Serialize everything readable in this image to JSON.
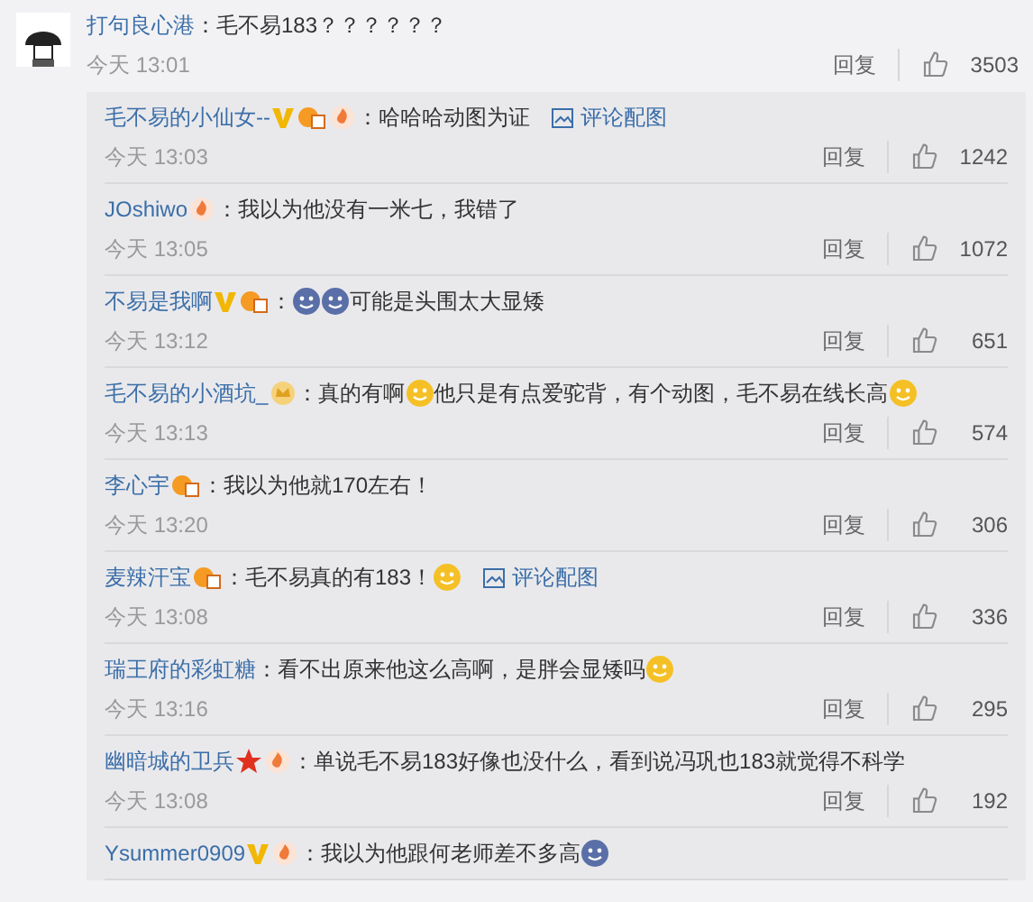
{
  "comment": {
    "name": "打句良心港",
    "segments": [
      {
        "kind": "text",
        "text": "：毛不易183？？？？？？"
      }
    ],
    "time": "今天 13:01",
    "reply_label": "回复",
    "likes": "3503"
  },
  "replies": [
    {
      "name": "毛不易的小仙女--",
      "badges": [
        {
          "kind": "vip"
        },
        {
          "kind": "fan"
        },
        {
          "kind": "flame"
        }
      ],
      "segments": [
        {
          "kind": "text",
          "text": "：哈哈哈动图为证"
        }
      ],
      "image_link": "评论配图",
      "time": "今天 13:03",
      "reply_label": "回复",
      "likes": "1242"
    },
    {
      "name": "JOshiwo",
      "badges": [
        {
          "kind": "flame"
        }
      ],
      "segments": [
        {
          "kind": "text",
          "text": "：我以为他没有一米七，我错了"
        }
      ],
      "time": "今天 13:05",
      "reply_label": "回复",
      "likes": "1072"
    },
    {
      "name": "不易是我啊",
      "badges": [
        {
          "kind": "vip"
        },
        {
          "kind": "fan"
        }
      ],
      "segments": [
        {
          "kind": "text",
          "text": "："
        },
        {
          "kind": "emoji",
          "color": "#5a6fa8"
        },
        {
          "kind": "emoji",
          "color": "#5a6fa8"
        },
        {
          "kind": "text",
          "text": "可能是头围太大显矮"
        }
      ],
      "time": "今天 13:12",
      "reply_label": "回复",
      "likes": "651"
    },
    {
      "name": "毛不易的小酒坑_",
      "badges": [
        {
          "kind": "crown"
        }
      ],
      "segments": [
        {
          "kind": "text",
          "text": "：真的有啊"
        },
        {
          "kind": "emoji",
          "color": "#f5c026"
        },
        {
          "kind": "text",
          "text": "他只是有点爱驼背，有个动图，毛不易在线长高"
        },
        {
          "kind": "emoji",
          "color": "#f5c026"
        }
      ],
      "time": "今天 13:13",
      "reply_label": "回复",
      "likes": "574"
    },
    {
      "name": "李心宇",
      "badges": [
        {
          "kind": "fan"
        }
      ],
      "segments": [
        {
          "kind": "text",
          "text": "：我以为他就170左右！"
        }
      ],
      "time": "今天 13:20",
      "reply_label": "回复",
      "likes": "306"
    },
    {
      "name": "麦辣汗宝",
      "badges": [
        {
          "kind": "fan"
        }
      ],
      "segments": [
        {
          "kind": "text",
          "text": "：毛不易真的有183！"
        },
        {
          "kind": "emoji",
          "color": "#f5c026"
        }
      ],
      "image_link": "评论配图",
      "time": "今天 13:08",
      "reply_label": "回复",
      "likes": "336"
    },
    {
      "name": "瑞王府的彩虹糖",
      "segments": [
        {
          "kind": "text",
          "text": "：看不出原来他这么高啊，是胖会显矮吗"
        },
        {
          "kind": "emoji",
          "color": "#f5c026"
        }
      ],
      "time": "今天 13:16",
      "reply_label": "回复",
      "likes": "295"
    },
    {
      "name": "幽暗城的卫兵",
      "badges": [
        {
          "kind": "star"
        },
        {
          "kind": "flame"
        }
      ],
      "segments": [
        {
          "kind": "text",
          "text": "：单说毛不易183好像也没什么，看到说冯巩也183就觉得不科学"
        }
      ],
      "time": "今天 13:08",
      "reply_label": "回复",
      "likes": "192"
    },
    {
      "name": "Ysummer0909",
      "badges": [
        {
          "kind": "vip"
        },
        {
          "kind": "flame"
        }
      ],
      "segments": [
        {
          "kind": "text",
          "text": "：我以为他跟何老师差不多高"
        },
        {
          "kind": "emoji",
          "color": "#5a6fa8"
        }
      ]
    }
  ]
}
